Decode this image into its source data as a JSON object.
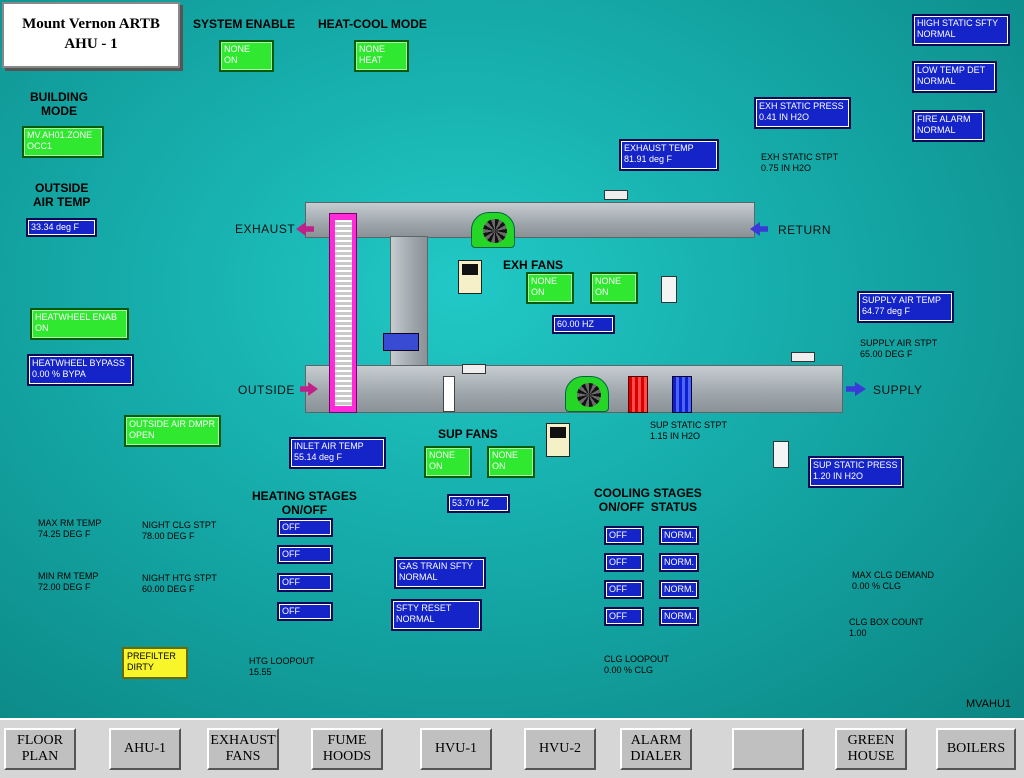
{
  "title": {
    "line1": "Mount Vernon ARTB",
    "line2": "AHU - 1"
  },
  "system_enable": {
    "header": "SYSTEM ENABLE",
    "value": "NONE\nON"
  },
  "heat_cool_mode": {
    "header": "HEAT-COOL MODE",
    "value": "NONE\nHEAT"
  },
  "building_mode": {
    "header": "BUILDING\nMODE",
    "value": "MV.AH01.ZONE\nOCC1"
  },
  "outside_air_temp": {
    "header": "OUTSIDE\nAIR TEMP",
    "value": "33.34 deg F"
  },
  "heatwheel_enab": "HEATWHEEL ENAB\nON",
  "heatwheel_bypass": "HEATWHEEL BYPASS\n0.00 % BYPA",
  "outside_air_dmpr": "OUTSIDE AIR DMPR\nOPEN",
  "inlet_air_temp": "INLET AIR TEMP\n55.14 deg F",
  "exhaust_temp": "EXHAUST TEMP\n81.91 deg F",
  "exh_static_press": "EXH STATIC PRESS\n0.41 IN H2O",
  "exh_static_stpt": "EXH STATIC STPT\n0.75 IN H2O",
  "high_static_sfty": "HIGH STATIC SFTY\nNORMAL",
  "low_temp_det": "LOW TEMP DET\nNORMAL",
  "fire_alarm": "FIRE ALARM\nNORMAL",
  "supply_air_temp": "SUPPLY AIR TEMP\n64.77 deg F",
  "supply_air_stpt": "SUPPLY AIR STPT\n65.00 DEG F",
  "sup_static_stpt": "SUP STATIC STPT\n1.15 IN H2O",
  "sup_static_press": "SUP STATIC PRESS\n1.20 IN H2O",
  "exh_fans": {
    "header": "EXH FANS",
    "fan1": "NONE\nON",
    "fan2": "NONE\nON",
    "speed": "60.00 HZ"
  },
  "sup_fans": {
    "header": "SUP FANS",
    "fan1": "NONE\nON",
    "fan2": "NONE\nON",
    "speed": "53.70 HZ"
  },
  "duct_labels": {
    "exhaust": "EXHAUST",
    "return": "RETURN",
    "outside": "OUTSIDE",
    "supply": "SUPPLY"
  },
  "heating": {
    "header": "HEATING STAGES\nON/OFF",
    "stages": [
      "OFF",
      "OFF",
      "OFF",
      "OFF"
    ]
  },
  "cooling": {
    "header": "COOLING STAGES\nON/OFF  STATUS",
    "stages": [
      "OFF",
      "OFF",
      "OFF",
      "OFF"
    ],
    "status": [
      "NORM.",
      "NORM.",
      "NORM.",
      "NORM."
    ]
  },
  "max_rm_temp": "MAX RM TEMP\n74.25 DEG F",
  "min_rm_temp": "MIN RM TEMP\n72.00 DEG F",
  "night_clg_stpt": "NIGHT CLG STPT\n78.00 DEG F",
  "night_htg_stpt": "NIGHT HTG STPT\n60.00 DEG F",
  "gas_train_sfty": "GAS TRAIN SFTY\nNORMAL",
  "sfty_reset": "SFTY RESET\nNORMAL",
  "prefilter": "PREFILTER\nDIRTY",
  "htg_loopout": "HTG LOOPOUT\n15.55",
  "clg_loopout": "CLG LOOPOUT\n0.00 % CLG",
  "max_clg_demand": "MAX CLG DEMAND\n0.00 % CLG",
  "clg_box_count": "CLG BOX COUNT\n1.00",
  "screen_id": "MVAHU1",
  "nav": [
    "FLOOR\nPLAN",
    "AHU-1",
    "EXHAUST\nFANS",
    "FUME\nHOODS",
    "HVU-1",
    "HVU-2",
    "ALARM\nDIALER",
    "",
    "GREEN\nHOUSE",
    "BOILERS"
  ],
  "colors": {
    "background": "#15aaa8",
    "value_box": "#1424c9",
    "status_box": "#2fe82f",
    "alarm_box": "#f8f52a"
  }
}
